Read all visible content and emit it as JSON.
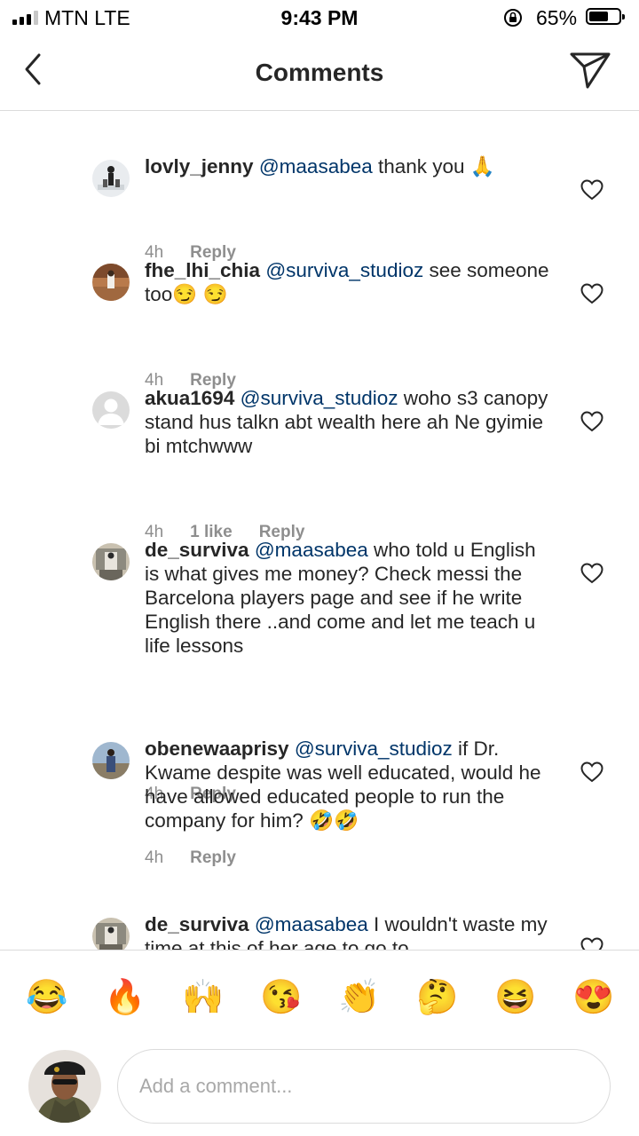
{
  "status_bar": {
    "carrier": "MTN  LTE",
    "time": "9:43 PM",
    "battery": "65%",
    "battery_level": 0.65
  },
  "nav": {
    "title": "Comments"
  },
  "comments": [
    {
      "username": "lovly_jenny",
      "mention": "@maasabea",
      "text": " thank you 🙏",
      "time": "4h",
      "likes": "",
      "reply": "Reply"
    },
    {
      "username": "fhe_lhi_chia",
      "mention": "@surviva_studioz",
      "text": " see someone too😏 😏",
      "time": "4h",
      "likes": "",
      "reply": "Reply"
    },
    {
      "username": "akua1694",
      "mention": "@surviva_studioz",
      "text": " woho s3 canopy stand hus talkn abt wealth here ah Ne gyimie bi mtchwww",
      "time": "4h",
      "likes": "1 like",
      "reply": "Reply"
    },
    {
      "username": "de_surviva",
      "mention": "@maasabea",
      "text": " who told u English is what gives me money? Check messi the Barcelona players page and see if he write English there ..and come and let me teach u life lessons",
      "time": "4h",
      "likes": "",
      "reply": "Reply"
    },
    {
      "username": "obenewaaprisy",
      "mention": "@surviva_studioz",
      "text": " if Dr. Kwame despite was well educated, would he have allowed educated people to run the company for him? 🤣🤣",
      "time": "4h",
      "likes": "",
      "reply": "Reply"
    },
    {
      "username": "de_surviva",
      "mention": "@maasabea",
      "text": " I wouldn't waste my time at this of her age to go to",
      "time": "",
      "likes": "",
      "reply": ""
    }
  ],
  "emoji_bar": [
    "😂",
    "🔥",
    "🙌",
    "😘",
    "👏",
    "🤔",
    "😆",
    "😍"
  ],
  "comment_input": {
    "placeholder": "Add a comment..."
  }
}
